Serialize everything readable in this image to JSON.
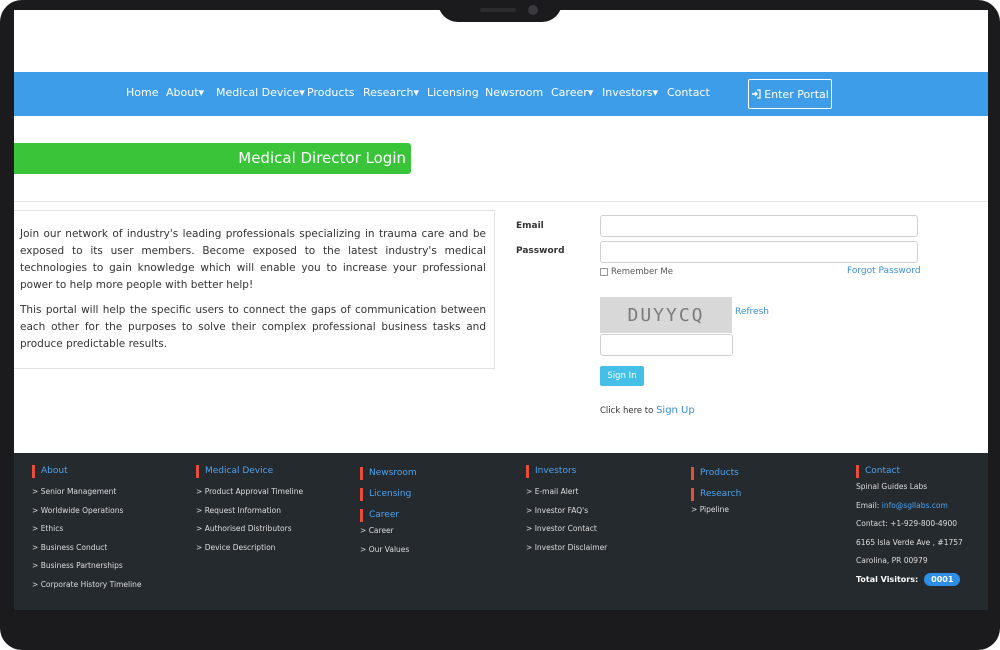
{
  "nav": {
    "items": [
      "Home",
      "About",
      "Medical Device",
      "Products",
      "Research",
      "Licensing",
      "Newsroom",
      "Career",
      "Investors",
      "Contact"
    ],
    "dropdown_marker": "▾",
    "enter_portal": "Enter Portal"
  },
  "login": {
    "title": "Medical Director Login",
    "intro_paragraph_1": "Join our network of industry's leading professionals specializing in trauma care and be exposed to its user members. Become exposed to the latest industry's medical technologies to gain knowledge which will enable you to increase your professional power to help more people with better help!",
    "intro_paragraph_2": "This portal will help the specific users to connect the gaps of communication between each other for the purposes to solve their complex professional business tasks and produce predictable results.",
    "email_label": "Email",
    "password_label": "Password",
    "remember_me": "Remember Me",
    "forgot_password": "Forgot Password",
    "captcha_text": "DUYYCQ",
    "refresh": "Refresh",
    "sign_in": "Sign In",
    "signup_prefix": "Click here to",
    "signup_link": "Sign Up"
  },
  "footer": {
    "about": {
      "heading": "About",
      "items": [
        "Senior Management",
        "Worldwide Operations",
        "Ethics",
        "Business Conduct",
        "Business Partnerships",
        "Corporate History Timeline"
      ]
    },
    "medical_device": {
      "heading": "Medical Device",
      "items": [
        "Product Approval Timeline",
        "Request Information",
        "Authorised Distributors",
        "Device Description"
      ]
    },
    "newsroom": {
      "heading": "Newsroom"
    },
    "licensing": {
      "heading": "Licensing"
    },
    "career": {
      "heading": "Career",
      "items": [
        "Career",
        "Our Values"
      ]
    },
    "investors": {
      "heading": "Investors",
      "items": [
        "E-mail Alert",
        "Investor FAQ's",
        "Investor Contact",
        "Investor Disclaimer"
      ]
    },
    "products": {
      "heading": "Products"
    },
    "research": {
      "heading": "Research",
      "items": [
        "Pipeline"
      ]
    },
    "contact": {
      "heading": "Contact",
      "company": "Spinal Guides Labs",
      "email_label": "Email:",
      "email": "info@sgllabs.com",
      "phone": "Contact: +1-929-800-4900",
      "address_1": "6165 Isla Verde Ave , #1757",
      "address_2": "Carolina, PR 00979",
      "visitors_label": "Total Visitors:",
      "visitors_count": "0001"
    },
    "link_marker": ">"
  },
  "colors": {
    "nav_bar": "#3e9de8",
    "login_banner": "#39c43a",
    "footer_bg": "#252a2f",
    "footer_accent": "#e94e3d",
    "link": "#3a8fd8"
  },
  "icons": {
    "enter_portal": "sign-in-icon"
  }
}
